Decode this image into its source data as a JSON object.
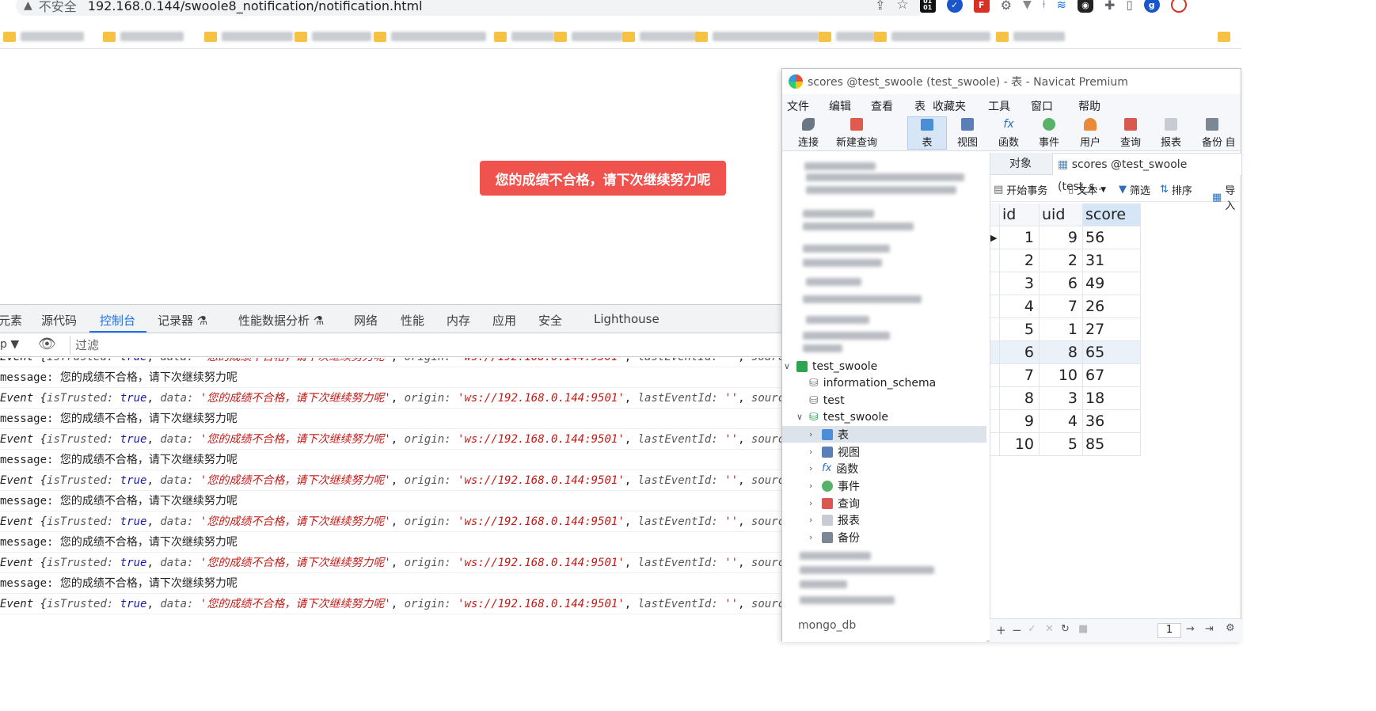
{
  "browser": {
    "insecure_label": "不安全",
    "url": "192.168.0.144/swoole8_notification/notification.html"
  },
  "page": {
    "toast_text": "您的成绩不合格，请下次继续努力呢"
  },
  "devtools": {
    "tabs": [
      "元素",
      "源代码",
      "控制台",
      "记录器",
      "性能数据分析",
      "网络",
      "性能",
      "内存",
      "应用",
      "安全",
      "Lighthouse"
    ],
    "active_tab": "控制台",
    "context_label": "p ▼",
    "filter_placeholder": "过滤",
    "event_line": {
      "prefix": "Event {",
      "k_trusted": "isTrusted",
      "v_trusted": "true",
      "k_data": "data",
      "v_data": "'您的成绩不合格，请下次继续努力呢'",
      "k_origin": "origin",
      "v_origin": "'ws://192.168.0.144:9501'",
      "k_last": "lastEventId",
      "v_last": "''",
      "k_source": "sourc"
    },
    "message_line": {
      "prefix": "message: ",
      "text": "您的成绩不合格，请下次继续努力呢"
    }
  },
  "navicat": {
    "title": "scores @test_swoole (test_swoole) - 表 - Navicat Premium",
    "menu": [
      "文件",
      "编辑",
      "查看",
      "表",
      "收藏夹",
      "工具",
      "窗口",
      "帮助"
    ],
    "toolbar": {
      "connect": "连接",
      "new_query": "新建查询",
      "table": "表",
      "view": "视图",
      "function": "函数",
      "event": "事件",
      "user": "用户",
      "query": "查询",
      "report": "报表",
      "backup": "备份",
      "auto": "自"
    },
    "tree": {
      "conn": "test_swoole",
      "db1": "information_schema",
      "db2": "test",
      "db3": "test_swoole",
      "items": [
        "表",
        "视图",
        "函数",
        "事件",
        "查询",
        "报表",
        "备份"
      ],
      "bottom": "mongo_db"
    },
    "tabs": {
      "objects": "对象",
      "scores": "scores @test_swoole (test_s..."
    },
    "actions": {
      "begin": "开始事务",
      "text": "文本",
      "filter": "筛选",
      "sort": "排序",
      "import": "导入"
    },
    "grid": {
      "headers": [
        "id",
        "uid",
        "score"
      ],
      "rows": [
        [
          "1",
          "9",
          "56"
        ],
        [
          "2",
          "2",
          "31"
        ],
        [
          "3",
          "6",
          "49"
        ],
        [
          "4",
          "7",
          "26"
        ],
        [
          "5",
          "1",
          "27"
        ],
        [
          "6",
          "8",
          "65"
        ],
        [
          "7",
          "10",
          "67"
        ],
        [
          "8",
          "3",
          "18"
        ],
        [
          "9",
          "4",
          "36"
        ],
        [
          "10",
          "5",
          "85"
        ]
      ]
    },
    "status": {
      "buttons": [
        "+",
        "−",
        "✓",
        "✕",
        "↻",
        "■"
      ],
      "page": "1"
    }
  },
  "colors": {
    "toast_bg": "#f0534e",
    "devtools_active": "#1a73e8",
    "string_red": "#c41a16",
    "bool_blue": "#1a1aa6"
  }
}
